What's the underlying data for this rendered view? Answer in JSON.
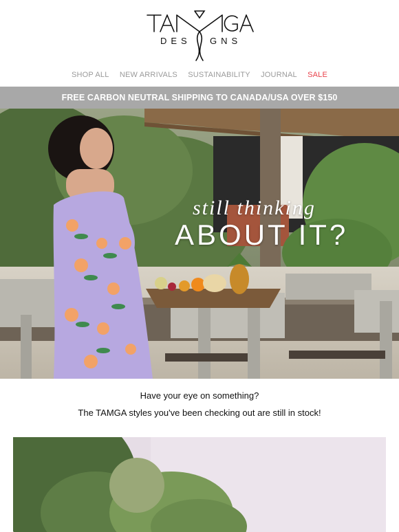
{
  "brand": {
    "line1": "TAMGA",
    "line2": "DESIGNS"
  },
  "nav": {
    "items": [
      {
        "label": "SHOP ALL"
      },
      {
        "label": "NEW ARRIVALS"
      },
      {
        "label": "SUSTAINABILITY"
      },
      {
        "label": "JOURNAL"
      },
      {
        "label": "SALE"
      }
    ]
  },
  "banner": {
    "text": "FREE CARBON NEUTRAL SHIPPING TO CANADA/USA OVER $150"
  },
  "hero": {
    "script_text": "still thinking",
    "title_text": "ABOUT IT?"
  },
  "copy": {
    "line1": "Have your eye on something?",
    "line2": "The TAMGA styles you've been checking out are still in stock!"
  },
  "colors": {
    "banner_bg": "#a8a8a8",
    "nav_text": "#9a9a9a",
    "sale": "#e8404a"
  }
}
